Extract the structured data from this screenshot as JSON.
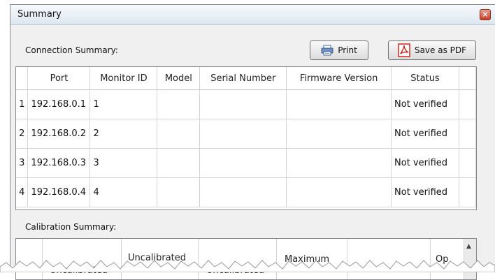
{
  "window": {
    "title": "Summary",
    "close_glyph": "×"
  },
  "connection": {
    "label": "Connection Summary:",
    "print_label": "Print",
    "save_pdf_label": "Save as PDF",
    "columns": [
      "",
      "Port",
      "Monitor ID",
      "Model",
      "Serial Number",
      "Firmware Version",
      "Status"
    ],
    "rows": [
      [
        "1",
        "192.168.0.1",
        "1",
        "",
        "",
        "",
        "Not verified"
      ],
      [
        "2",
        "192.168.0.2",
        "2",
        "",
        "",
        "",
        "Not verified"
      ],
      [
        "3",
        "192.168.0.3",
        "3",
        "",
        "",
        "",
        "Not verified"
      ],
      [
        "4",
        "192.168.0.4",
        "4",
        "",
        "",
        "",
        "Not verified"
      ]
    ]
  },
  "calibration": {
    "label": "Calibration Summary:",
    "headers": [
      "Uncalibrated",
      "Uncalibrated",
      "Uncalibrated",
      "Maximum",
      "Op"
    ]
  },
  "icons": {
    "print": "printer-icon",
    "pdf": "pdf-icon",
    "close": "close-icon",
    "scroll_up": "scroll-up-arrow-icon"
  },
  "colors": {
    "pdf_red": "#d0271d",
    "titlebar": "#dde6f0",
    "grid_border": "#828790"
  }
}
